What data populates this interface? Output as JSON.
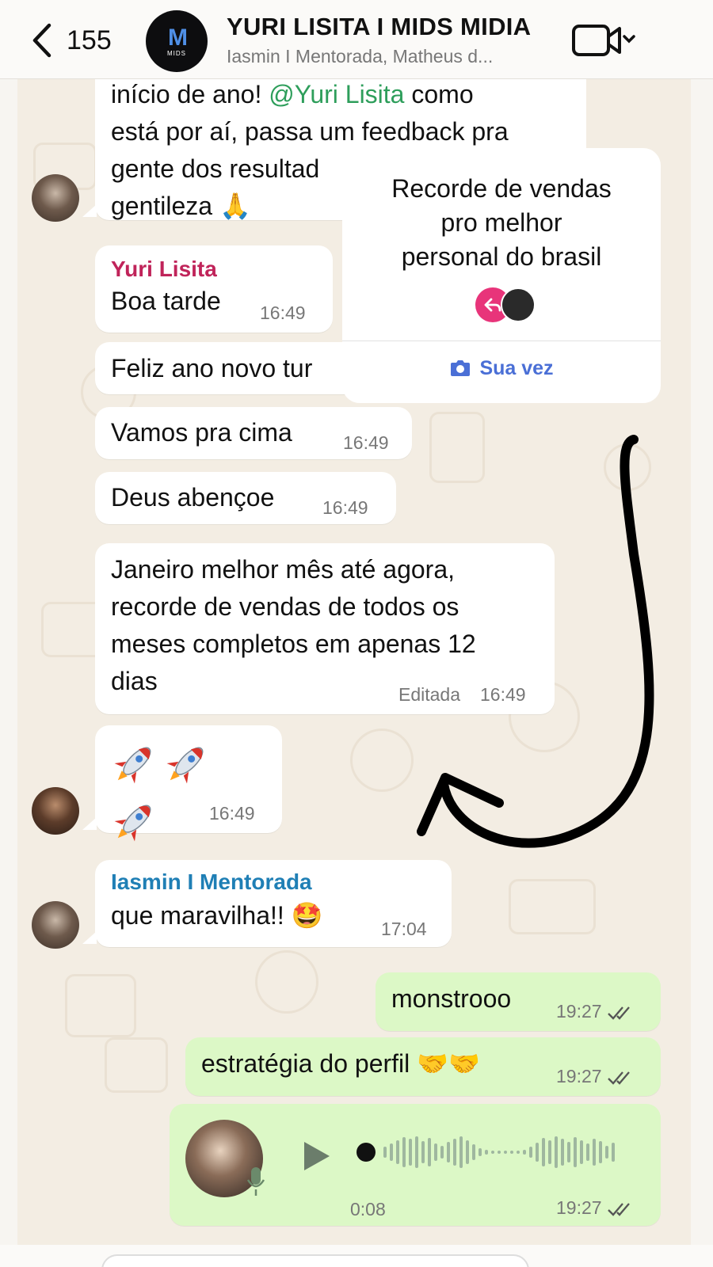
{
  "header": {
    "back_count": "155",
    "logo_text": "MIDS",
    "title": "YURI LISITA I MIDS MIDIA",
    "subtitle": "Iasmin I Mentorada, Matheus d..."
  },
  "messages": {
    "m1_lines": [
      "início de ano! @Yuri Lisita como",
      "está por aí, passa um feedback pra",
      "gente dos resultad",
      "gentileza 🙏"
    ],
    "m2_sender": "Yuri Lisita",
    "m2_text": "Boa tarde",
    "m2_time": "16:49",
    "m3_text": "Feliz ano novo tur",
    "m4_text": "Vamos pra cima",
    "m4_time": "16:49",
    "m5_text": "Deus abençoe",
    "m5_time": "16:49",
    "m6_lines": [
      "Janeiro melhor mês até agora,",
      "recorde de vendas de todos os",
      "meses completos em apenas 12",
      "dias"
    ],
    "m6_edited": "Editada",
    "m6_time": "16:49",
    "m7_time": "16:49",
    "m8_sender": "Iasmin I Mentorada",
    "m8_text": "que maravilha!! 🤩",
    "m8_time": "17:04",
    "m9_text": "monstrooo",
    "m9_time": "19:27",
    "m10_text": "estratégia do perfil 🤝🤝",
    "m10_time": "19:27",
    "audio_duration": "0:08",
    "audio_time": "19:27"
  },
  "overlay_card": {
    "lines": [
      "Recorde de vendas",
      "pro melhor",
      "personal do brasil"
    ],
    "cta": "Sua vez"
  },
  "colors": {
    "sender_yuri": "#c0245a",
    "sender_iasmin": "#1f7fb5",
    "mention": "#2e9e5b",
    "outgoing_bubble": "#dcf8c6",
    "card_cta": "#4a6fd6"
  },
  "icons": [
    "back-chevron-icon",
    "video-call-icon",
    "chevron-down-icon",
    "reply-icon",
    "camera-icon",
    "read-ticks-icon",
    "play-icon",
    "mic-icon",
    "rocket-emoji"
  ]
}
